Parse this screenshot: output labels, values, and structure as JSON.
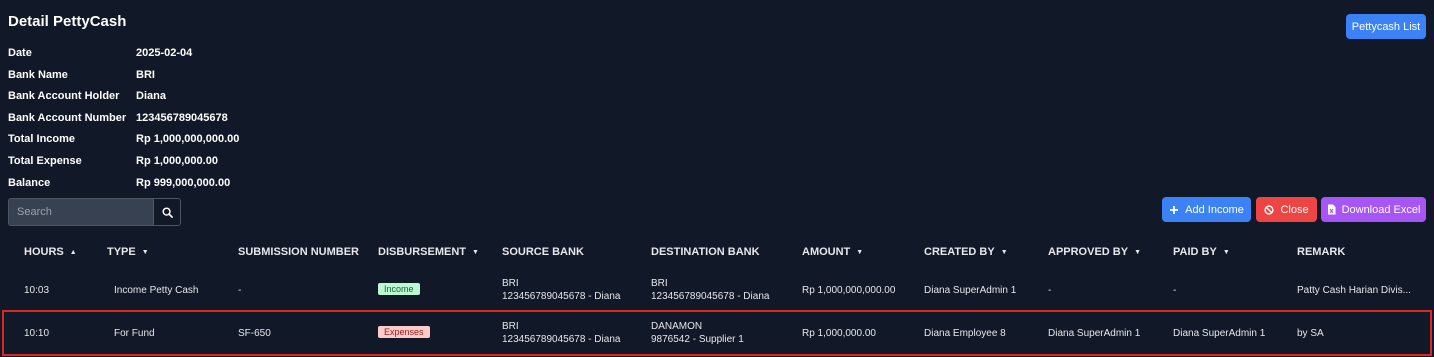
{
  "page": {
    "title": "Detail PettyCash"
  },
  "actions": {
    "list_label": "Pettycash List",
    "add_income_label": "Add Income",
    "close_label": "Close",
    "download_label": "Download Excel"
  },
  "info": [
    {
      "label": "Date",
      "value": "2025-02-04"
    },
    {
      "label": "Bank Name",
      "value": "BRI"
    },
    {
      "label": "Bank Account Holder",
      "value": "Diana"
    },
    {
      "label": "Bank Account Number",
      "value": "123456789045678"
    },
    {
      "label": "Total Income",
      "value": "Rp 1,000,000,000.00"
    },
    {
      "label": "Total Expense",
      "value": "Rp 1,000,000.00"
    },
    {
      "label": "Balance",
      "value": "Rp 999,000,000.00"
    }
  ],
  "search": {
    "placeholder": "Search"
  },
  "table": {
    "headers": [
      "HOURS",
      "TYPE",
      "SUBMISSION NUMBER",
      "DISBURSEMENT",
      "SOURCE BANK",
      "DESTINATION BANK",
      "AMOUNT",
      "CREATED BY",
      "APPROVED BY",
      "PAID BY",
      "REMARK"
    ],
    "rows": [
      {
        "hours": "10:03",
        "type": "Income Petty Cash",
        "submission": "-",
        "disbursement": "Income",
        "source_bank": "BRI",
        "source_account": "123456789045678 - Diana",
        "dest_bank": "BRI",
        "dest_account": "123456789045678 - Diana",
        "amount": "Rp 1,000,000,000.00",
        "created_by": "Diana SuperAdmin 1",
        "approved_by": "-",
        "paid_by": "-",
        "remark": "Patty Cash Harian Divis..."
      },
      {
        "hours": "10:10",
        "type": "For Fund",
        "submission": "SF-650",
        "disbursement": "Expenses",
        "source_bank": "BRI",
        "source_account": "123456789045678 - Diana",
        "dest_bank": "DANAMON",
        "dest_account": "9876542 - Supplier 1",
        "amount": "Rp 1,000,000.00",
        "created_by": "Diana Employee 8",
        "approved_by": "Diana SuperAdmin 1",
        "paid_by": "Diana SuperAdmin 1",
        "remark": "by SA"
      }
    ]
  },
  "colors": {
    "background": "#111827",
    "primary": "#3b82f6",
    "danger": "#ef4444",
    "purple": "#a855f7",
    "highlight": "#dc2626"
  }
}
